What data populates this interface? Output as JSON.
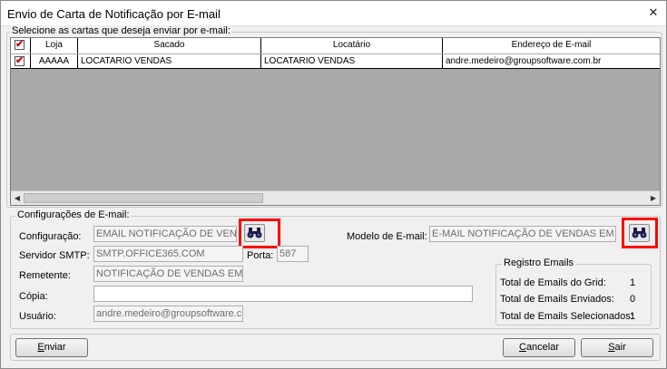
{
  "window": {
    "title": "Envio de Carta de Notificação por E-mail",
    "close_glyph": "✕"
  },
  "selection_group": {
    "label": "Selecione as cartas que deseja enviar por e-mail:"
  },
  "grid": {
    "headers": [
      "",
      "Loja",
      "Sacado",
      "Locatário",
      "Endereço de E-mail"
    ],
    "rows": [
      {
        "checked": true,
        "loja": "AAAAA",
        "sacado": "LOCATARIO VENDAS",
        "locatario": "LOCATARIO VENDAS",
        "email": "andre.medeiro@groupsoftware.com.br"
      }
    ]
  },
  "email_config": {
    "label": "Configurações de E-mail:",
    "configuracao": {
      "label": "Configuração:",
      "value": "EMAIL NOTIFICAÇÃO DE VENDAS"
    },
    "servidor": {
      "label": "Servidor SMTP:",
      "value": "SMTP.OFFICE365.COM"
    },
    "porta": {
      "label": "Porta:",
      "value": "587"
    },
    "remetente": {
      "label": "Remetente:",
      "value": "NOTIFICAÇÃO DE VENDAS EM ATRASO"
    },
    "copia": {
      "label": "Cópia:",
      "value": ""
    },
    "usuario": {
      "label": "Usuário:",
      "value": "andre.medeiro@groupsoftware.com.br"
    },
    "modelo": {
      "label": "Modelo de E-mail:",
      "value": "E-MAIL NOTIFICAÇÃO DE VENDAS EM ATRASO"
    }
  },
  "registro": {
    "label": "Registro Emails",
    "items": [
      {
        "label": "Total de Emails do Grid:",
        "value": "1"
      },
      {
        "label": "Total de Emails Enviados:",
        "value": "0"
      },
      {
        "label": "Total de Emails Selecionados:",
        "value": "1"
      }
    ]
  },
  "buttons": {
    "enviar": {
      "first": "E",
      "rest": "nviar"
    },
    "cancelar": {
      "first": "C",
      "rest": "ancelar"
    },
    "sair": {
      "first": "S",
      "rest": "air"
    }
  },
  "icons": {
    "search": "binoculars-icon",
    "check": "checkmark-icon"
  },
  "colors": {
    "highlight": "#ff0000",
    "check": "#d00000",
    "grid_empty": "#a9a9a9"
  }
}
